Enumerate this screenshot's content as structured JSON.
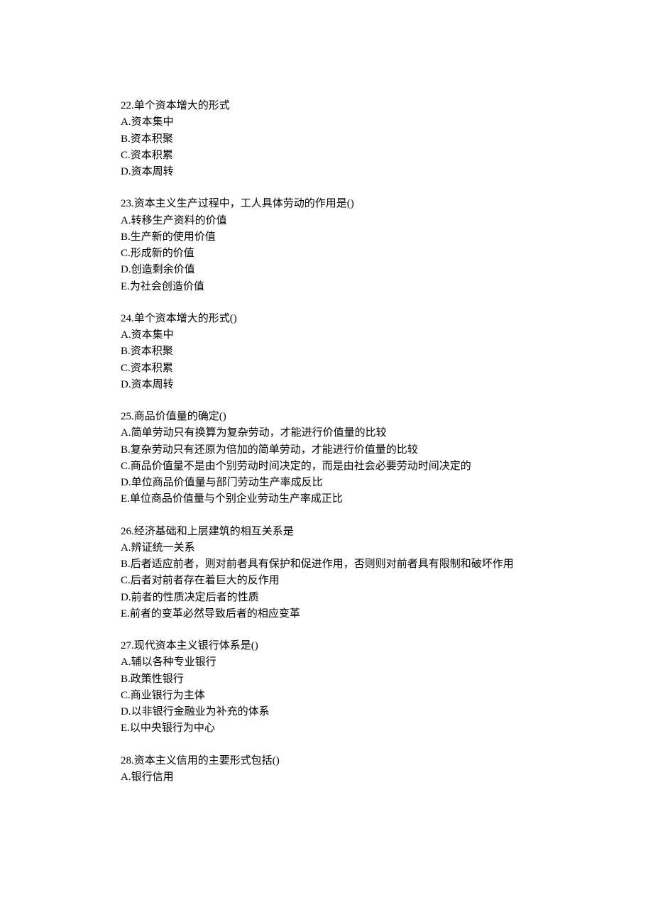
{
  "questions": [
    {
      "number": "22",
      "text": "单个资本增大的形式",
      "options": [
        {
          "letter": "A",
          "text": "资本集中"
        },
        {
          "letter": "B",
          "text": "资本积聚"
        },
        {
          "letter": "C",
          "text": "资本积累"
        },
        {
          "letter": "D",
          "text": "资本周转"
        }
      ]
    },
    {
      "number": "23",
      "text": "资本主义生产过程中，工人具体劳动的作用是()",
      "options": [
        {
          "letter": "A",
          "text": "转移生产资料的价值"
        },
        {
          "letter": "B",
          "text": "生产新的使用价值"
        },
        {
          "letter": "C",
          "text": "形成新的价值"
        },
        {
          "letter": "D",
          "text": "创造剩余价值"
        },
        {
          "letter": "E",
          "text": "为社会创造价值"
        }
      ]
    },
    {
      "number": "24",
      "text": "单个资本增大的形式()",
      "options": [
        {
          "letter": "A",
          "text": "资本集中"
        },
        {
          "letter": "B",
          "text": "资本积聚"
        },
        {
          "letter": "C",
          "text": "资本积累"
        },
        {
          "letter": "D",
          "text": "资本周转"
        }
      ]
    },
    {
      "number": "25",
      "text": "商品价值量的确定()",
      "options": [
        {
          "letter": "A",
          "text": "简单劳动只有换算为复杂劳动，才能进行价值量的比较"
        },
        {
          "letter": "B",
          "text": "复杂劳动只有还原为倍加的简单劳动，才能进行价值量的比较"
        },
        {
          "letter": "C",
          "text": "商品价值量不是由个别劳动时间决定的，而是由社会必要劳动时间决定的"
        },
        {
          "letter": "D",
          "text": "单位商品价值量与部门劳动生产率成反比"
        },
        {
          "letter": "E",
          "text": "单位商品价值量与个别企业劳动生产率成正比"
        }
      ]
    },
    {
      "number": "26",
      "text": "经济基础和上层建筑的相互关系是",
      "options": [
        {
          "letter": "A",
          "text": "辨证统一关系"
        },
        {
          "letter": "B",
          "text": "后者适应前者，则对前者具有保护和促进作用，否则则对前者具有限制和破坏作用"
        },
        {
          "letter": "C",
          "text": "后者对前者存在着巨大的反作用"
        },
        {
          "letter": "D",
          "text": "前者的性质决定后者的性质"
        },
        {
          "letter": "E",
          "text": "前者的变革必然导致后者的相应变革"
        }
      ]
    },
    {
      "number": "27",
      "text": "现代资本主义银行体系是()",
      "options": [
        {
          "letter": "A",
          "text": "辅以各种专业银行"
        },
        {
          "letter": "B",
          "text": "政策性银行"
        },
        {
          "letter": "C",
          "text": "商业银行为主体"
        },
        {
          "letter": "D",
          "text": "以非银行金融业为补充的体系"
        },
        {
          "letter": "E",
          "text": "以中央银行为中心"
        }
      ]
    },
    {
      "number": "28",
      "text": "资本主义信用的主要形式包括()",
      "options": [
        {
          "letter": "A",
          "text": "银行信用"
        }
      ]
    }
  ]
}
